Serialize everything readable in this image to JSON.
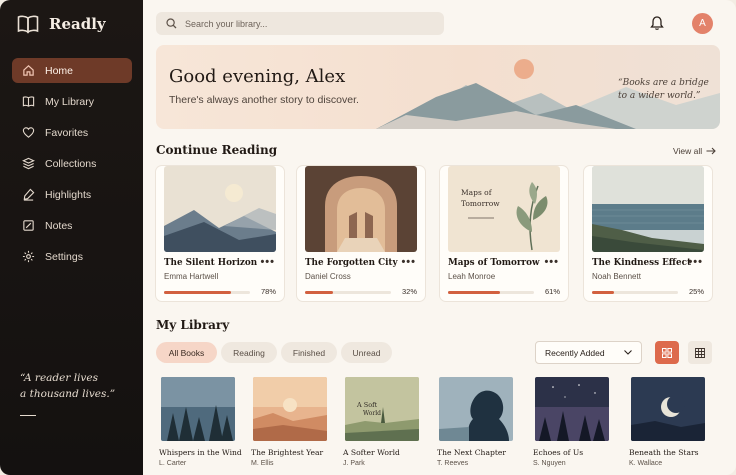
{
  "app": {
    "name": "Readly"
  },
  "sidebar": {
    "items": [
      {
        "label": "Home",
        "icon": "home-icon",
        "active": true
      },
      {
        "label": "My Library",
        "icon": "book-icon"
      },
      {
        "label": "Favorites",
        "icon": "heart-icon"
      },
      {
        "label": "Collections",
        "icon": "collections-icon"
      },
      {
        "label": "Highlights",
        "icon": "highlight-icon"
      },
      {
        "label": "Notes",
        "icon": "notes-icon"
      },
      {
        "label": "Settings",
        "icon": "gear-icon"
      }
    ],
    "quote_line1": "“A reader lives",
    "quote_line2": "a thousand lives.”"
  },
  "header": {
    "search_placeholder": "Search your library...",
    "avatar_initial": "A"
  },
  "hero": {
    "greeting": "Good evening, Alex",
    "subtitle": "There's always another story to discover.",
    "quote_line1": "“Books are a bridge",
    "quote_line2": "to a wider world.”"
  },
  "continue_reading": {
    "title": "Continue Reading",
    "view_all": "View all",
    "books": [
      {
        "title": "The Silent Horizon",
        "author": "Emma Hartwell",
        "progress": 78,
        "progress_label": "78%"
      },
      {
        "title": "The Forgotten City",
        "author": "Daniel Cross",
        "progress": 32,
        "progress_label": "32%"
      },
      {
        "title": "Maps of Tomorrow",
        "author": "Leah Monroe",
        "progress": 61,
        "progress_label": "61%",
        "cover_text1": "Maps of",
        "cover_text2": "Tomorrow"
      },
      {
        "title": "The Kindness Effect",
        "author": "Noah Bennett",
        "progress": 25,
        "progress_label": "25%"
      }
    ]
  },
  "library": {
    "title": "My Library",
    "filters": [
      "All Books",
      "Reading",
      "Finished",
      "Unread"
    ],
    "active_filter": "All Books",
    "sort_label": "Recently Added",
    "books": [
      {
        "title": "Whispers in the Wind",
        "author": "L. Carter"
      },
      {
        "title": "The Brightest Year",
        "author": "M. Ellis"
      },
      {
        "title": "A Softer World",
        "author": "J. Park",
        "cover_text1": "A Soft",
        "cover_text2": "World"
      },
      {
        "title": "The Next Chapter",
        "author": "T. Reeves"
      },
      {
        "title": "Echoes of Us",
        "author": "S. Nguyen"
      },
      {
        "title": "Beneath the Stars",
        "author": "K. Wallace"
      }
    ]
  },
  "colors": {
    "accent": "#d2603f",
    "sidebar_bg": "#171311",
    "active_nav": "#6e3a28"
  }
}
